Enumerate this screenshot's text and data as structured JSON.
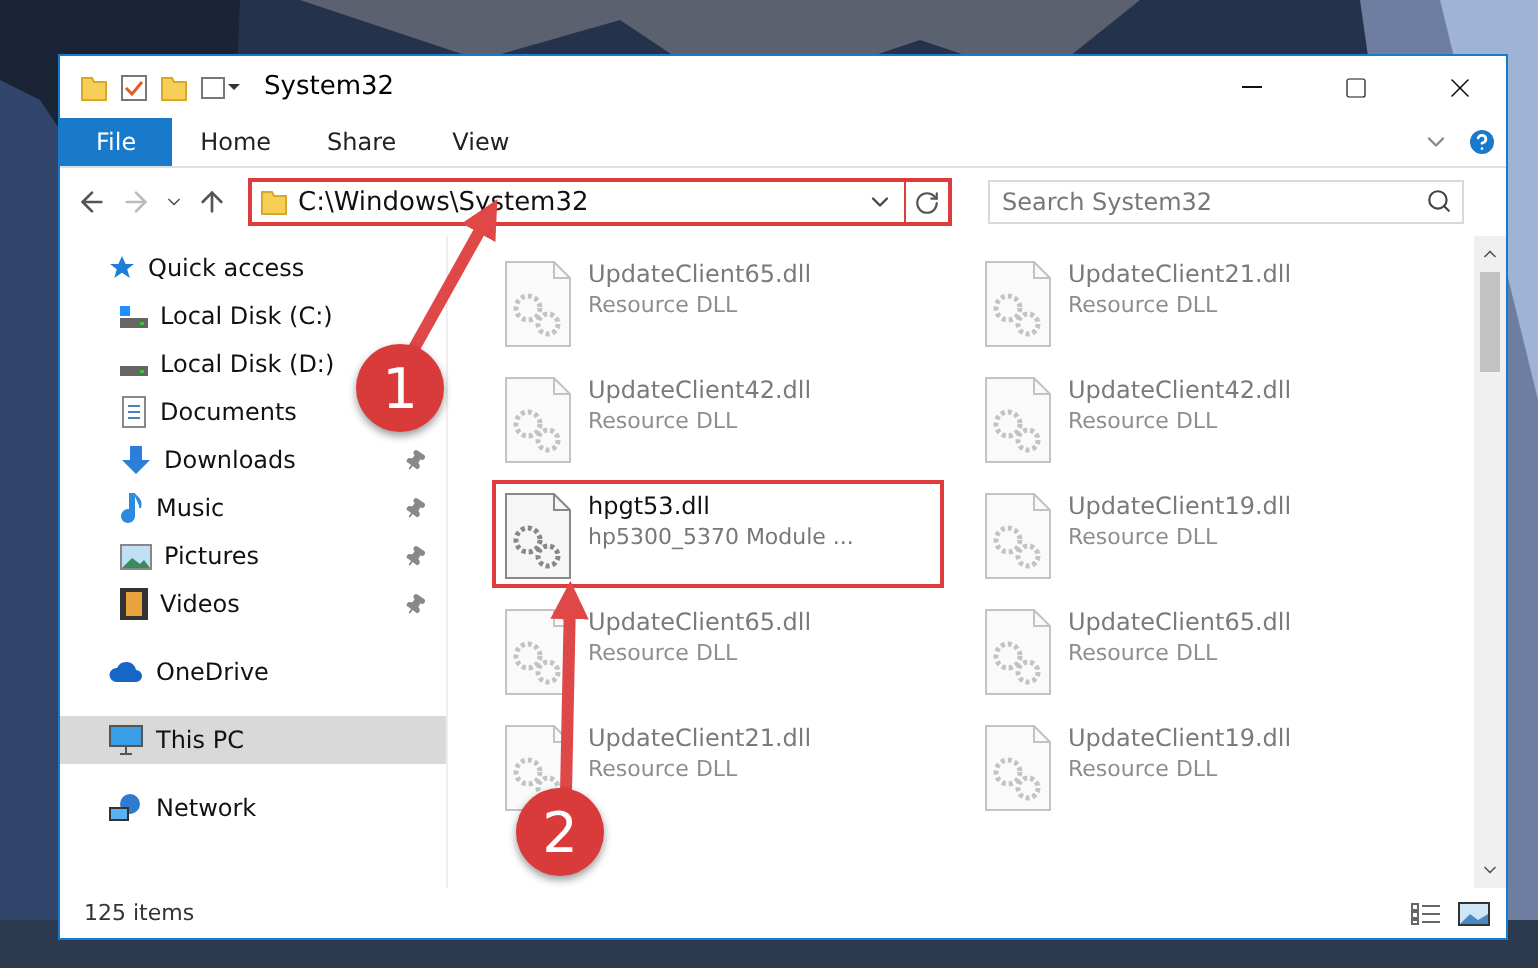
{
  "window": {
    "title": "System32"
  },
  "ribbon": {
    "tabs": [
      {
        "label": "File",
        "selected": true
      },
      {
        "label": "Home",
        "selected": false
      },
      {
        "label": "Share",
        "selected": false
      },
      {
        "label": "View",
        "selected": false
      }
    ]
  },
  "address_bar": {
    "path": "C:\\Windows\\System32",
    "highlighted": true
  },
  "search": {
    "placeholder": "Search System32"
  },
  "sidebar": {
    "items": [
      {
        "label": "Quick access",
        "selected": false,
        "children": [
          {
            "label": "Local Disk (C:)",
            "pinned": false,
            "selected": false
          },
          {
            "label": "Local Disk (D:)",
            "pinned": false,
            "selected": false
          },
          {
            "label": "Documents",
            "pinned": false,
            "selected": false
          },
          {
            "label": "Downloads",
            "pinned": true,
            "selected": false
          },
          {
            "label": "Music",
            "pinned": true,
            "selected": false
          },
          {
            "label": "Pictures",
            "pinned": true,
            "selected": false
          },
          {
            "label": "Videos",
            "pinned": true,
            "selected": false
          }
        ]
      },
      {
        "label": "OneDrive",
        "selected": false
      },
      {
        "label": "This PC",
        "selected": true
      },
      {
        "label": "Network",
        "selected": false
      }
    ]
  },
  "files": [
    {
      "name": "UpdateClient65.dll",
      "description": "Resource DLL",
      "blurred": true,
      "highlighted": false
    },
    {
      "name": "UpdateClient21.dll",
      "description": "Resource DLL",
      "blurred": true,
      "highlighted": false
    },
    {
      "name": "UpdateClient42.dll",
      "description": "Resource DLL",
      "blurred": true,
      "highlighted": false
    },
    {
      "name": "UpdateClient42.dll",
      "description": "Resource DLL",
      "blurred": true,
      "highlighted": false
    },
    {
      "name": "hpgt53.dll",
      "description": "hp5300_5370 Module ...",
      "blurred": false,
      "highlighted": true
    },
    {
      "name": "UpdateClient19.dll",
      "description": "Resource DLL",
      "blurred": true,
      "highlighted": false
    },
    {
      "name": "UpdateClient65.dll",
      "description": "Resource DLL",
      "blurred": true,
      "highlighted": false
    },
    {
      "name": "UpdateClient65.dll",
      "description": "Resource DLL",
      "blurred": true,
      "highlighted": false
    },
    {
      "name": "UpdateClient21.dll",
      "description": "Resource DLL",
      "blurred": true,
      "highlighted": false
    },
    {
      "name": "UpdateClient19.dll",
      "description": "Resource DLL",
      "blurred": true,
      "highlighted": false
    }
  ],
  "status_bar": {
    "count": "125 items"
  },
  "callouts": [
    {
      "label": "1"
    },
    {
      "label": "2"
    }
  ]
}
